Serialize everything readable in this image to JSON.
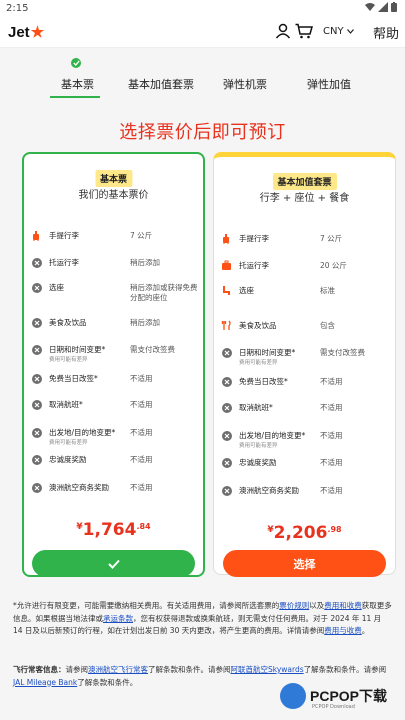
{
  "status_bar": {
    "time": "2:15"
  },
  "header": {
    "logo_text": "Jet",
    "logo_star": "★",
    "currency": "CNY",
    "help": "帮助"
  },
  "progress": {
    "steps": [
      "基本票",
      "基本加值套票",
      "弹性机票",
      "弹性加值"
    ],
    "active_index": 0
  },
  "promo_text": "选择票价后即可预订",
  "fares": [
    {
      "badge": "基本票",
      "subtitle": "我们的基本票价",
      "selected": true,
      "features": [
        {
          "icon": "carry-on-bag-icon",
          "included": true,
          "name": "手提行李",
          "value": "7 公斤"
        },
        {
          "icon": "x-circle-icon",
          "included": false,
          "name": "托运行李",
          "value": "稍后添加"
        },
        {
          "icon": "x-circle-icon",
          "included": false,
          "name": "选座",
          "value": "稍后添加或获得免费分配的座位"
        },
        {
          "icon": "x-circle-icon",
          "included": false,
          "name": "美食及饮品",
          "value": "稍后添加"
        },
        {
          "icon": "x-circle-icon",
          "included": false,
          "name": "日期和时间变更*",
          "note": "费用可能有差异",
          "value": "需支付改签费"
        },
        {
          "icon": "x-circle-icon",
          "included": false,
          "name": "免费当日改签*",
          "value": "不适用"
        },
        {
          "icon": "x-circle-icon",
          "included": false,
          "name": "取消航班*",
          "value": "不适用"
        },
        {
          "icon": "x-circle-icon",
          "included": false,
          "name": "出发地/目的地变更*",
          "note": "费用可能有差异",
          "value": "不适用"
        },
        {
          "icon": "x-circle-icon",
          "included": false,
          "name": "忠诚度奖励",
          "value": "不适用"
        },
        {
          "icon": "x-circle-icon",
          "included": false,
          "name": "澳洲航空商务奖励",
          "value": "不适用"
        }
      ],
      "price": {
        "currency": "¥",
        "amount": "1,764",
        "decimal": ".84"
      }
    },
    {
      "badge": "基本加值套票",
      "subtitle": "行李 + 座位 + 餐食",
      "selected": false,
      "button": "选择",
      "features": [
        {
          "icon": "carry-on-bag-icon",
          "included": true,
          "name": "手提行李",
          "value": "7 公斤"
        },
        {
          "icon": "checked-bag-icon",
          "included": true,
          "name": "托运行李",
          "value": "20 公斤"
        },
        {
          "icon": "seat-icon",
          "included": true,
          "name": "选座",
          "value": "标准"
        },
        {
          "icon": "cutlery-icon",
          "included": true,
          "name": "美食及饮品",
          "value": "包含"
        },
        {
          "icon": "x-circle-icon",
          "included": false,
          "name": "日期和时间变更*",
          "note": "费用可能有差异",
          "value": "需支付改签费"
        },
        {
          "icon": "x-circle-icon",
          "included": false,
          "name": "免费当日改签*",
          "value": "不适用"
        },
        {
          "icon": "x-circle-icon",
          "included": false,
          "name": "取消航班*",
          "value": "不适用"
        },
        {
          "icon": "x-circle-icon",
          "included": false,
          "name": "出发地/目的地变更*",
          "note": "费用可能有差异",
          "value": "不适用"
        },
        {
          "icon": "x-circle-icon",
          "included": false,
          "name": "忠诚度奖励",
          "value": "不适用"
        },
        {
          "icon": "x-circle-icon",
          "included": false,
          "name": "澳洲航空商务奖励",
          "value": "不适用"
        }
      ],
      "price": {
        "currency": "¥",
        "amount": "2,206",
        "decimal": ".98"
      }
    }
  ],
  "notes": {
    "p1": "*允许进行有限变更，可能需要缴纳相关费用。有关适用费用，请参阅所选套票的",
    "link_fare_rules": "票价规则",
    "p2": "以及",
    "link_fees": "费用和收费",
    "p3": "获取更多信息。如果根据当地法律或",
    "link_conditions": "承运条款",
    "p4": "，您有权获得退款或换乘航班，则无需支付任何费用。对于 2024 年 11 月 14 日及以后新预订的行程，如在计划出发日前 30 天内更改，将产生更高的费用。详情请参阅",
    "link_fees2": "费用与收费",
    "p5": "。"
  },
  "frequent_flyer": {
    "label": "飞行常客信息：",
    "t1": "请参阅",
    "link_qantas": "澳洲航空飞行常客",
    "t2": "了解条款和条件。请参阅",
    "link_emirates": "阿联酋航空Skywards",
    "t3": "了解条款和条件。请参阅",
    "link_jal": "JAL Mileage Bank",
    "t4": "了解条款和条件。"
  },
  "watermark": {
    "text": "PCPOP下载",
    "sub": "PCPOP Download"
  },
  "colors": {
    "accent": "#ff5115",
    "green": "#2fb34a",
    "price": "#e8321e",
    "badge": "#ffe88a",
    "link": "#1a4ec2"
  }
}
